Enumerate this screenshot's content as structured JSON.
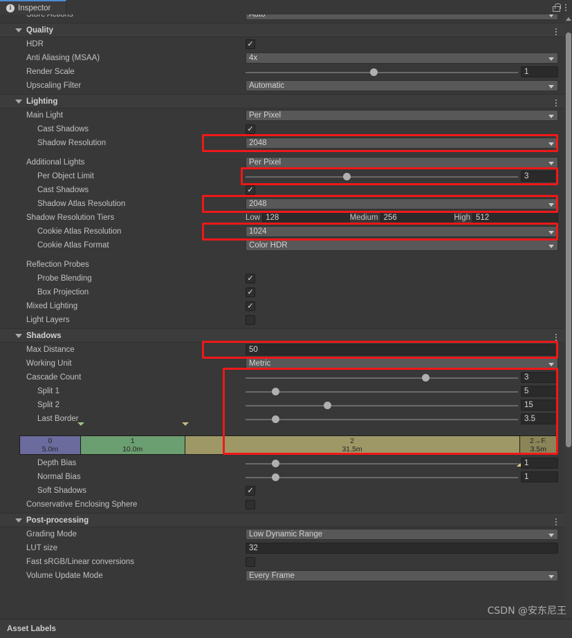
{
  "window": {
    "tab_label": "Inspector",
    "info_icon": "info-icon",
    "lock_icon": "lock-icon",
    "menu_icon": "kebab-menu-icon"
  },
  "clipped_top_row": {
    "label": "Store Actions",
    "value": "Auto"
  },
  "sections": [
    {
      "name": "quality",
      "title": "Quality",
      "rows": [
        {
          "label": "HDR",
          "indent": 1,
          "control": "checkbox",
          "checked": true
        },
        {
          "label": "Anti Aliasing (MSAA)",
          "indent": 1,
          "control": "dropdown",
          "value": "4x"
        },
        {
          "label": "Render Scale",
          "indent": 1,
          "control": "slider",
          "value": "1",
          "knob_pct": 47
        },
        {
          "label": "Upscaling Filter",
          "indent": 1,
          "control": "dropdown",
          "value": "Automatic"
        }
      ]
    },
    {
      "name": "lighting",
      "title": "Lighting",
      "rows": [
        {
          "label": "Main Light",
          "indent": 1,
          "control": "dropdown",
          "value": "Per Pixel"
        },
        {
          "label": "Cast Shadows",
          "indent": 2,
          "control": "checkbox",
          "checked": true
        },
        {
          "label": "Shadow Resolution",
          "indent": 2,
          "control": "dropdown",
          "value": "2048",
          "highlight": true
        },
        {
          "label": "",
          "indent": 0,
          "control": "spacer"
        },
        {
          "label": "Additional Lights",
          "indent": 1,
          "control": "dropdown",
          "value": "Per Pixel"
        },
        {
          "label": "Per Object Limit",
          "indent": 2,
          "control": "slider",
          "value": "3",
          "knob_pct": 37,
          "highlight": true
        },
        {
          "label": "Cast Shadows",
          "indent": 2,
          "control": "checkbox",
          "checked": true
        },
        {
          "label": "Shadow Atlas Resolution",
          "indent": 2,
          "control": "dropdown",
          "value": "2048",
          "highlight": true
        },
        {
          "label": "Shadow Resolution Tiers",
          "indent": 1,
          "control": "tiers",
          "tiers": [
            {
              "label": "Low",
              "value": "128"
            },
            {
              "label": "Medium",
              "value": "256"
            },
            {
              "label": "High",
              "value": "512"
            }
          ]
        },
        {
          "label": "Cookie Atlas Resolution",
          "indent": 2,
          "control": "dropdown",
          "value": "1024",
          "highlight": true
        },
        {
          "label": "Cookie Atlas Format",
          "indent": 2,
          "control": "dropdown",
          "value": "Color HDR"
        },
        {
          "label": "",
          "indent": 0,
          "control": "spacer"
        },
        {
          "label": "Reflection Probes",
          "indent": 1,
          "control": "none"
        },
        {
          "label": "Probe Blending",
          "indent": 2,
          "control": "checkbox",
          "checked": true
        },
        {
          "label": "Box Projection",
          "indent": 2,
          "control": "checkbox",
          "checked": true
        },
        {
          "label": "Mixed Lighting",
          "indent": 1,
          "control": "checkbox",
          "checked": true
        },
        {
          "label": "Light Layers",
          "indent": 1,
          "control": "checkbox",
          "checked": false
        }
      ]
    },
    {
      "name": "shadows",
      "title": "Shadows",
      "rows": [
        {
          "label": "Max Distance",
          "indent": 1,
          "control": "textfield",
          "value": "50",
          "highlight": true
        },
        {
          "label": "Working Unit",
          "indent": 1,
          "control": "dropdown",
          "value": "Metric"
        },
        {
          "label": "Cascade Count",
          "indent": 1,
          "control": "slider",
          "value": "3",
          "knob_pct": 66
        },
        {
          "label": "Split 1",
          "indent": 2,
          "control": "slider",
          "value": "5",
          "knob_pct": 11
        },
        {
          "label": "Split 2",
          "indent": 2,
          "control": "slider",
          "value": "15",
          "knob_pct": 30
        },
        {
          "label": "Last Border",
          "indent": 2,
          "control": "slider",
          "value": "3.5",
          "knob_pct": 11
        },
        {
          "label": "",
          "indent": 0,
          "control": "cascade"
        },
        {
          "label": "Depth Bias",
          "indent": 2,
          "control": "slider",
          "value": "1",
          "knob_pct": 11
        },
        {
          "label": "Normal Bias",
          "indent": 2,
          "control": "slider",
          "value": "1",
          "knob_pct": 11
        },
        {
          "label": "Soft Shadows",
          "indent": 2,
          "control": "checkbox",
          "checked": true
        },
        {
          "label": "Conservative Enclosing Sphere",
          "indent": 1,
          "control": "checkbox",
          "checked": false
        }
      ]
    },
    {
      "name": "post-processing",
      "title": "Post-processing",
      "rows": [
        {
          "label": "Grading Mode",
          "indent": 1,
          "control": "dropdown",
          "value": "Low Dynamic Range"
        },
        {
          "label": "LUT size",
          "indent": 1,
          "control": "textfield",
          "value": "32"
        },
        {
          "label": "Fast sRGB/Linear conversions",
          "indent": 1,
          "control": "checkbox",
          "checked": false
        },
        {
          "label": "Volume Update Mode",
          "indent": 1,
          "control": "dropdown",
          "value": "Every Frame"
        }
      ]
    }
  ],
  "cascade_bar": {
    "segments": [
      {
        "id": "0",
        "index": "0",
        "distance": "5.0m",
        "width_pct": 11.3,
        "color": "#6b6b9e"
      },
      {
        "id": "1",
        "index": "1",
        "distance": "10.0m",
        "width_pct": 19.4,
        "color": "#6b9e70"
      },
      {
        "id": "2",
        "index": "2",
        "distance": "31.5m",
        "width_pct": 62.3,
        "color": "#9e9866"
      },
      {
        "id": "2toF",
        "index": "2→F.",
        "distance": "3.5m",
        "width_pct": 7.0,
        "color": "#8b8457"
      }
    ],
    "handles": [
      {
        "pos_pct": 11.3,
        "color": "#9ec48a"
      },
      {
        "pos_pct": 30.7,
        "color": "#c5bc84"
      }
    ],
    "bottom_handle": {
      "pos_pct": 93.0,
      "color": "#d8cf8e"
    }
  },
  "bottom": {
    "asset_labels": "Asset Labels",
    "watermark": "CSDN @安东尼王"
  },
  "colors": {
    "highlight": "#f01818",
    "tab_accent": "#4d8ad4",
    "panel_bg": "#383838",
    "header_bg": "#3c3c3c"
  }
}
